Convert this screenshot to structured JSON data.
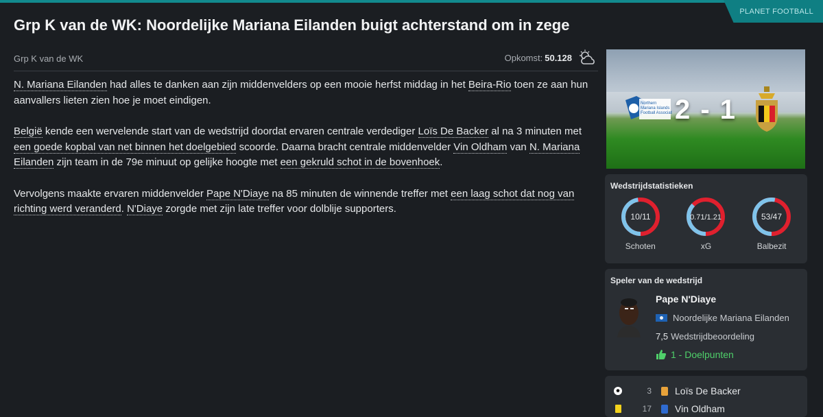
{
  "brand": "PLANET FOOTBALL",
  "headline": "Grp K van de WK: Noordelijke Mariana Eilanden buigt achterstand om in zege",
  "competition": "Grp K van de WK",
  "attendance": {
    "label": "Opkomst:",
    "value": "50.128",
    "icon": "partly-cloudy-icon"
  },
  "article": {
    "p1": [
      {
        "t": "N. Mariana Eilanden",
        "link": true
      },
      {
        "t": " had alles te danken aan zijn middenvelders op een mooie herfst middag in het ",
        "link": false
      },
      {
        "t": "Beira-Rio",
        "link": true
      },
      {
        "t": " toen ze aan hun aanvallers lieten zien hoe je moet eindigen.",
        "link": false
      }
    ],
    "p2": [
      {
        "t": "België",
        "link": true
      },
      {
        "t": " kende een wervelende start van de wedstrijd doordat ervaren centrale verdediger ",
        "link": false
      },
      {
        "t": "Loïs De Backer",
        "link": true
      },
      {
        "t": " al na 3 minuten met ",
        "link": false
      },
      {
        "t": "een goede kopbal van net binnen het doelgebied",
        "link": true
      },
      {
        "t": " scoorde. Daarna bracht centrale middenvelder ",
        "link": false
      },
      {
        "t": "Vin Oldham",
        "link": true
      },
      {
        "t": " van ",
        "link": false
      },
      {
        "t": "N. Mariana Eilanden",
        "link": true
      },
      {
        "t": " zijn team in de 79e minuut op gelijke hoogte met ",
        "link": false
      },
      {
        "t": "een gekruld schot in de bovenhoek",
        "link": true
      },
      {
        "t": ".",
        "link": false
      }
    ],
    "p3": [
      {
        "t": "Vervolgens maakte ervaren middenvelder ",
        "link": false
      },
      {
        "t": "Pape N'Diaye",
        "link": true
      },
      {
        "t": " na 85 minuten de winnende treffer met ",
        "link": false
      },
      {
        "t": "een laag schot dat nog van richting werd veranderd",
        "link": true
      },
      {
        "t": ". ",
        "link": false
      },
      {
        "t": "N'Diaye",
        "link": true
      },
      {
        "t": " zorgde met zijn late treffer voor dolblije supporters.",
        "link": false
      }
    ]
  },
  "score": "2 - 1",
  "home_crest_text": "Northern Mariana Islands Football Association",
  "stats": {
    "title": "Wedstrijdstatistieken",
    "items": [
      {
        "label": "Schoten",
        "value": "10/11",
        "home_share": 0.476
      },
      {
        "label": "xG",
        "value": "0.71/1.21",
        "home_share": 0.37
      },
      {
        "label": "Balbezit",
        "value": "53/47",
        "home_share": 0.53
      }
    ],
    "colors": {
      "home": "#7fc3ea",
      "away": "#e0202e"
    }
  },
  "player_of_match": {
    "title": "Speler van de wedstrijd",
    "name": "Pape N'Diaye",
    "club": "Noordelijke Mariana Eilanden",
    "rating": "7,5",
    "rating_label": "Wedstrijdbeoordeling",
    "goals": "1 - Doelpunten"
  },
  "events": [
    {
      "icon": "ball-icon",
      "minute": "3",
      "player": "Loïs De Backer"
    },
    {
      "icon": "yellow-card-icon",
      "minute": "17",
      "player": "Vin Oldham"
    }
  ]
}
